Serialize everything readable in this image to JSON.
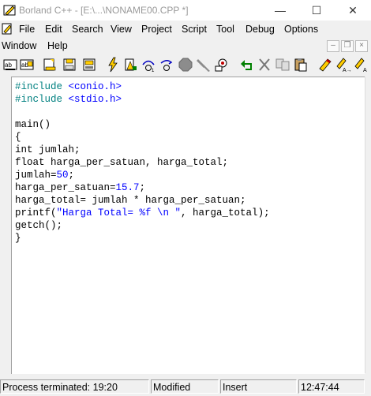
{
  "window": {
    "title": "Borland C++ - [E:\\...\\NONAME00.CPP *]",
    "minimize_glyph": "—",
    "maximize_glyph": "☐",
    "close_glyph": "✕"
  },
  "menu": {
    "row1": [
      "File",
      "Edit",
      "Search",
      "View",
      "Project",
      "Script",
      "Tool",
      "Debug",
      "Options"
    ],
    "row2": [
      "Window",
      "Help"
    ],
    "mdi_buttons": [
      "–",
      "❐",
      "×"
    ]
  },
  "toolbar": {
    "buttons": [
      "select-icon",
      "select-all-icon",
      "open-file-icon",
      "save-file-icon",
      "print-icon",
      "lightning-icon",
      "build-icon",
      "step-over-icon",
      "step-into-icon",
      "stop-icon",
      "tool-icon",
      "find-icon",
      "undo-icon",
      "cut-icon",
      "copy-icon",
      "paste-icon",
      "pencil-icon",
      "pencil-ab-icon",
      "pencil-a-icon"
    ]
  },
  "editor": {
    "lines": [
      [
        {
          "t": "#include ",
          "c": "dir"
        },
        {
          "t": "<conio.h>",
          "c": "str"
        }
      ],
      [
        {
          "t": "#include ",
          "c": "dir"
        },
        {
          "t": "<stdio.h>",
          "c": "str"
        }
      ],
      [
        {
          "t": "",
          "c": ""
        }
      ],
      [
        {
          "t": "main()",
          "c": ""
        }
      ],
      [
        {
          "t": "{",
          "c": ""
        }
      ],
      [
        {
          "t": "int jumlah;",
          "c": ""
        }
      ],
      [
        {
          "t": "float harga_per_satuan, harga_total;",
          "c": ""
        }
      ],
      [
        {
          "t": "jumlah=",
          "c": ""
        },
        {
          "t": "50",
          "c": "num"
        },
        {
          "t": ";",
          "c": ""
        }
      ],
      [
        {
          "t": "harga_per_satuan=",
          "c": ""
        },
        {
          "t": "15.7",
          "c": "num"
        },
        {
          "t": ";",
          "c": ""
        }
      ],
      [
        {
          "t": "harga_total= jumlah * harga_per_satuan;",
          "c": ""
        }
      ],
      [
        {
          "t": "printf(",
          "c": ""
        },
        {
          "t": "\"Harga Total= %f \\n \"",
          "c": "str"
        },
        {
          "t": ", harga_total);",
          "c": ""
        }
      ],
      [
        {
          "t": "getch();",
          "c": ""
        }
      ],
      [
        {
          "t": "}",
          "c": ""
        }
      ]
    ]
  },
  "status": {
    "message": "Process terminated: 19:20",
    "modified": "Modified",
    "mode": "Insert",
    "time": "12:47:44"
  }
}
